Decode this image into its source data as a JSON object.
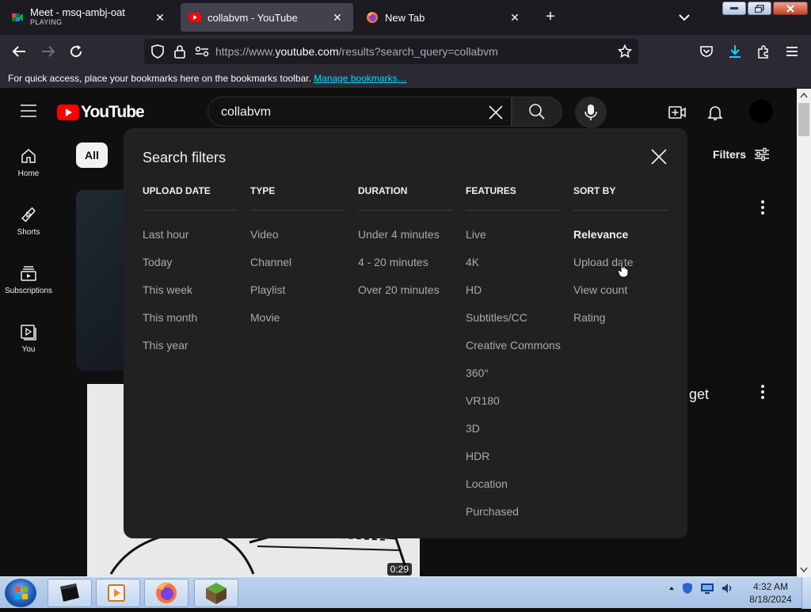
{
  "tabs": [
    {
      "title": "Meet - msq-ambj-oat",
      "subtitle": "PLAYING",
      "icon": "meet-icon"
    },
    {
      "title": "collabvm - YouTube",
      "icon": "youtube-icon"
    },
    {
      "title": "New Tab",
      "icon": "firefox-icon"
    }
  ],
  "address_bar": {
    "url_prefix": "https://www.",
    "url_host": "youtube.com",
    "url_path": "/results?search_query=collabvm"
  },
  "bookmarks_bar": {
    "message": "For quick access, place your bookmarks here on the bookmarks toolbar. ",
    "link": "Manage bookmarks…"
  },
  "youtube": {
    "logo_text": "YouTube",
    "search_query": "collabvm",
    "guide": [
      {
        "label": "Home",
        "icon": "home-icon"
      },
      {
        "label": "Shorts",
        "icon": "shorts-icon"
      },
      {
        "label": "Subscriptions",
        "icon": "subscriptions-icon"
      },
      {
        "label": "You",
        "icon": "you-icon"
      }
    ],
    "chip_all": "All",
    "filters_label": "Filters",
    "partial_title_fragment": "get",
    "video_duration": "0:29"
  },
  "search_filters": {
    "title": "Search filters",
    "columns": [
      {
        "header": "UPLOAD DATE",
        "options": [
          "Last hour",
          "Today",
          "This week",
          "This month",
          "This year"
        ]
      },
      {
        "header": "TYPE",
        "options": [
          "Video",
          "Channel",
          "Playlist",
          "Movie"
        ]
      },
      {
        "header": "DURATION",
        "options": [
          "Under 4 minutes",
          "4 - 20 minutes",
          "Over 20 minutes"
        ]
      },
      {
        "header": "FEATURES",
        "options": [
          "Live",
          "4K",
          "HD",
          "Subtitles/CC",
          "Creative Commons",
          "360°",
          "VR180",
          "3D",
          "HDR",
          "Location",
          "Purchased"
        ]
      },
      {
        "header": "SORT BY",
        "options": [
          "Relevance",
          "Upload date",
          "View count",
          "Rating"
        ],
        "selected": "Relevance"
      }
    ]
  },
  "taskbar": {
    "time": "4:32 AM",
    "date": "8/18/2024"
  },
  "colors": {
    "yt_background": "#0f0f0f",
    "dialog_background": "#212121",
    "yt_red": "#ff0000",
    "link_color": "#00ddff"
  }
}
